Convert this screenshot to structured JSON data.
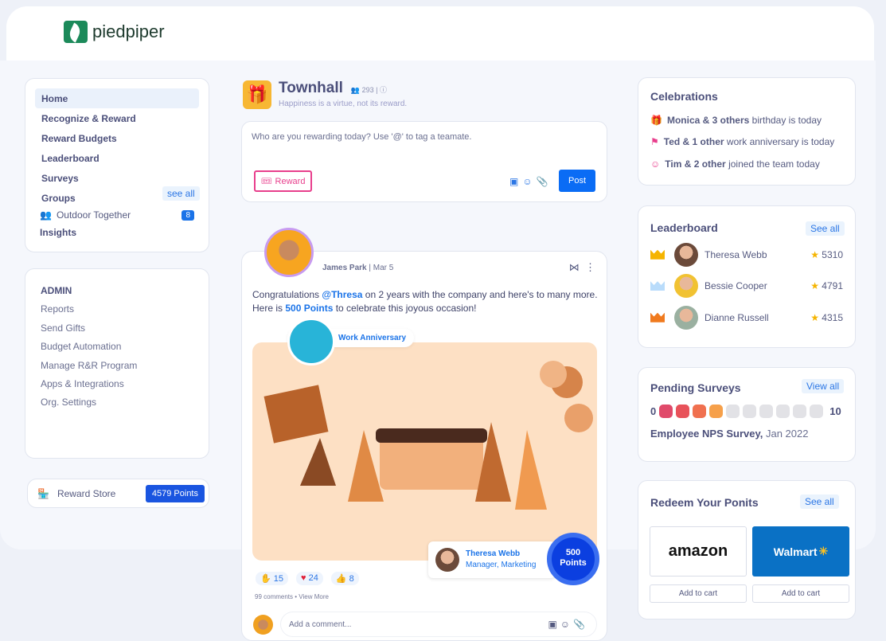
{
  "brand": "piedpiper",
  "nav": {
    "items": [
      "Home",
      "Recognize & Reward",
      "Reward Budgets",
      "Leaderboard",
      "Surveys",
      "Groups"
    ],
    "see_all": "see all",
    "group": "Outdoor Together",
    "group_count": "8",
    "insights": "Insights"
  },
  "admin": {
    "title": "ADMIN",
    "items": [
      "Reports",
      "Send Gifts",
      "Budget Automation",
      "Manage R&R Program",
      "Apps & Integrations",
      "Org. Settings"
    ]
  },
  "store": {
    "label": "Reward Store",
    "points": "4579 Points"
  },
  "channel": {
    "title": "Townhall",
    "members": "293",
    "subtitle": "Happiness is a virtue, not its reward."
  },
  "composer": {
    "placeholder": "Who are you rewarding today?  Use '@' to tag a teamate.",
    "reward": "Reward",
    "post": "Post"
  },
  "post": {
    "author": "James Park",
    "date": "Mar 5",
    "text_1": "Congratulations ",
    "mention": "@Thresa",
    "text_2": " on 2 years with the company and here's to many more. Here is ",
    "points": "500 Points",
    "text_3": " to celebrate this joyous occasion!",
    "badge": "Work Anniversary",
    "recipient": "Theresa Webb",
    "recipient_role": "Manager, Marketing",
    "award_num": "500",
    "award_unit": "Points",
    "reactions": [
      "15",
      "24",
      "8"
    ],
    "comments": "99 comments",
    "view_more": "View More",
    "comment_placeholder": "Add a comment..."
  },
  "celebrations": {
    "title": "Celebrations",
    "items": [
      {
        "bold": "Monica & 3 others",
        "rest": " birthday is today"
      },
      {
        "bold": "Ted & 1 other",
        "rest": " work anniversary is today"
      },
      {
        "bold": "Tim & 2 other",
        "rest": " joined the team today"
      }
    ]
  },
  "leaderboard": {
    "title": "Leaderboard",
    "see_all": "See all",
    "rows": [
      {
        "name": "Theresa Webb",
        "score": "5310",
        "crown": "#f5b400"
      },
      {
        "name": "Bessie Cooper",
        "score": "4791",
        "crown": "#b9dcfb"
      },
      {
        "name": "Dianne Russell",
        "score": "4315",
        "crown": "#f07a1e"
      }
    ]
  },
  "surveys": {
    "title": "Pending Surveys",
    "view_all": "View all",
    "min": "0",
    "max": "10",
    "score": 4,
    "colors": [
      "#e04a6a",
      "#e8525a",
      "#f0704f",
      "#f6a04a"
    ],
    "name": "Employee NPS Survey,",
    "date": " Jan 2022"
  },
  "redeem": {
    "title": "Redeem Your Ponits",
    "see_all": "See all",
    "items": [
      {
        "brand": "amazon",
        "cta": "Add to cart"
      },
      {
        "brand": "Walmart",
        "cta": "Add to cart"
      }
    ]
  }
}
